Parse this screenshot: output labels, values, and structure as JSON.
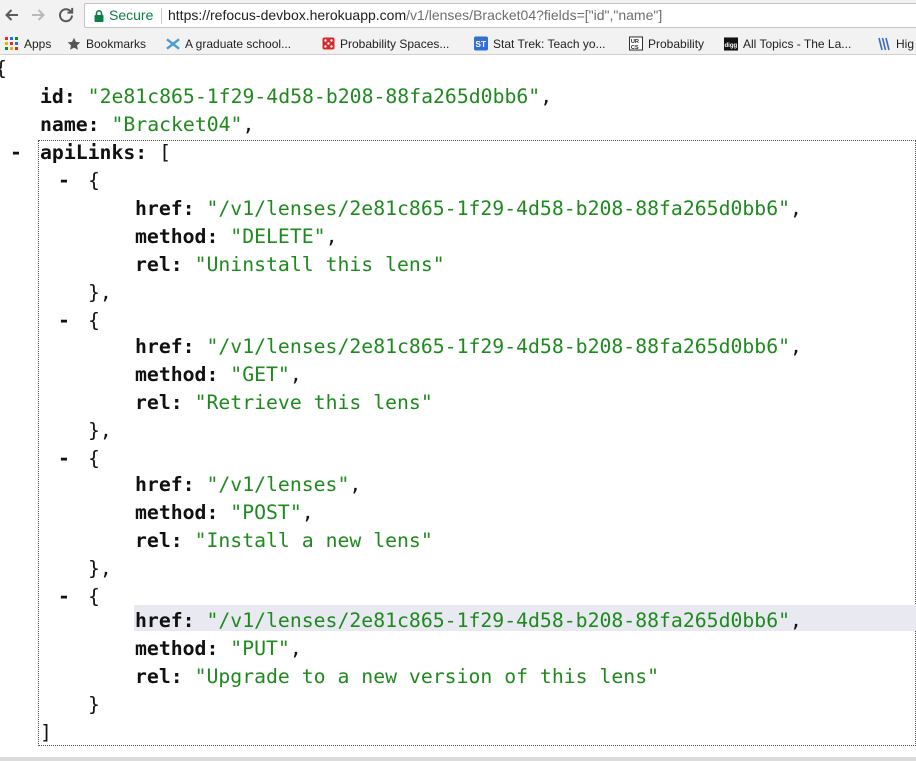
{
  "browser": {
    "secure_label": "Secure",
    "url_host": "https://refocus-devbox.herokuapp.com",
    "url_path": "/v1/lenses/Bracket04?fields=[\"id\",\"name\"]"
  },
  "bookmarks": [
    {
      "label": "Apps",
      "icon": "apps-grid-icon"
    },
    {
      "label": "Bookmarks",
      "icon": "star-icon"
    },
    {
      "label": "A graduate school...",
      "icon": "unc-logo-icon"
    },
    {
      "label": "Probability Spaces...",
      "icon": "dice-icon"
    },
    {
      "label": "Stat Trek: Teach yo...",
      "icon": "stattrek-icon"
    },
    {
      "label": "Probability",
      "icon": "urcs-icon"
    },
    {
      "label": "All Topics - The La...",
      "icon": "digg-icon"
    },
    {
      "label": "Hig",
      "icon": "bookmark-favicon-icon"
    }
  ],
  "json": {
    "open_brace": "{",
    "id_key": "id:",
    "id_value": "\"2e81c865-1f29-4d58-b208-88fa265d0bb6\"",
    "name_key": "name:",
    "name_value": "\"Bracket04\"",
    "api_links_key": "apiLinks:",
    "open_bracket": "[",
    "close_bracket": "]",
    "collapse_symbol": "-",
    "item_open": "{",
    "item_close": "},",
    "item_close_last": "}",
    "comma": ",",
    "href_key": "href:",
    "method_key": "method:",
    "rel_key": "rel:",
    "api_links": [
      {
        "href": "\"/v1/lenses/2e81c865-1f29-4d58-b208-88fa265d0bb6\"",
        "method": "\"DELETE\"",
        "rel": "\"Uninstall this lens\""
      },
      {
        "href": "\"/v1/lenses/2e81c865-1f29-4d58-b208-88fa265d0bb6\"",
        "method": "\"GET\"",
        "rel": "\"Retrieve this lens\""
      },
      {
        "href": "\"/v1/lenses\"",
        "method": "\"POST\"",
        "rel": "\"Install a new lens\""
      },
      {
        "href": "\"/v1/lenses/2e81c865-1f29-4d58-b208-88fa265d0bb6\"",
        "method": "\"PUT\"",
        "rel": "\"Upgrade to a new version of this lens\""
      }
    ]
  },
  "colors": {
    "string": "#1e8a1e",
    "key": "#111111",
    "secure": "#0b8043",
    "hover_row": "#e8e9f1"
  }
}
